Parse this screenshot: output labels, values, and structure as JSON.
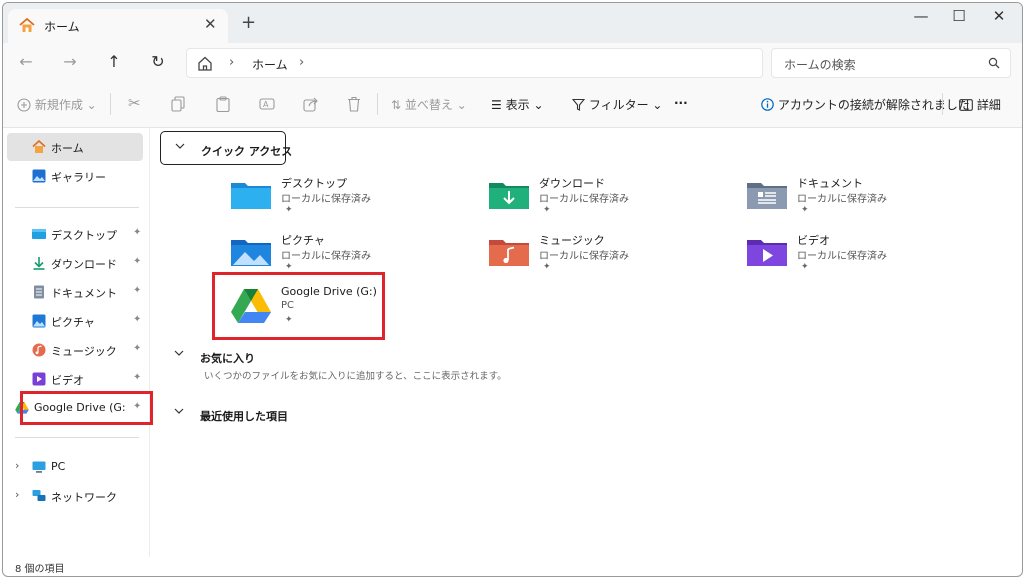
{
  "tab": {
    "title": "ホーム",
    "close": "✕",
    "new": "+"
  },
  "window_controls": {
    "minimize": "—",
    "maximize": "☐",
    "close": "✕"
  },
  "nav": {
    "back": "←",
    "forward": "→",
    "up": "↑",
    "refresh": "↻"
  },
  "address": {
    "sep": "›",
    "crumb": "ホーム",
    "trailing": "›"
  },
  "search": {
    "placeholder": "ホームの検索"
  },
  "toolbar": {
    "new": "新規作成",
    "sort": "並べ替え",
    "view": "表示",
    "filter": "フィルター",
    "more": "···",
    "account_notice": "アカウントの接続が解除されました",
    "details": "詳細",
    "dropdown": "⌄"
  },
  "sidebar": {
    "top": [
      {
        "label": "ホーム"
      },
      {
        "label": "ギャラリー"
      }
    ],
    "pinned": [
      {
        "label": "デスクトップ"
      },
      {
        "label": "ダウンロード"
      },
      {
        "label": "ドキュメント"
      },
      {
        "label": "ピクチャ"
      },
      {
        "label": "ミュージック"
      },
      {
        "label": "ビデオ"
      },
      {
        "label": "Google Drive (G:"
      }
    ],
    "bottom": [
      {
        "label": "PC"
      },
      {
        "label": "ネットワーク"
      }
    ],
    "pin_glyph": "📌",
    "chevron": "›"
  },
  "sections": {
    "quick_access": "クイック アクセス",
    "favorites": "お気に入り",
    "recent": "最近使用した項目",
    "favorites_empty": "いくつかのファイルをお気に入りに追加すると、ここに表示されます。"
  },
  "tiles": [
    {
      "name": "デスクトップ",
      "sub": "ローカルに保存済み"
    },
    {
      "name": "ダウンロード",
      "sub": "ローカルに保存済み"
    },
    {
      "name": "ドキュメント",
      "sub": "ローカルに保存済み"
    },
    {
      "name": "ピクチャ",
      "sub": "ローカルに保存済み"
    },
    {
      "name": "ミュージック",
      "sub": "ローカルに保存済み"
    },
    {
      "name": "ビデオ",
      "sub": "ローカルに保存済み"
    },
    {
      "name": "Google Drive (G:)",
      "sub": "PC"
    }
  ],
  "status": {
    "items": "8 個の項目"
  },
  "colors": {
    "highlight": "#e0242c",
    "accent": "#0067c0",
    "selected_bg": "#e3e3e3"
  }
}
